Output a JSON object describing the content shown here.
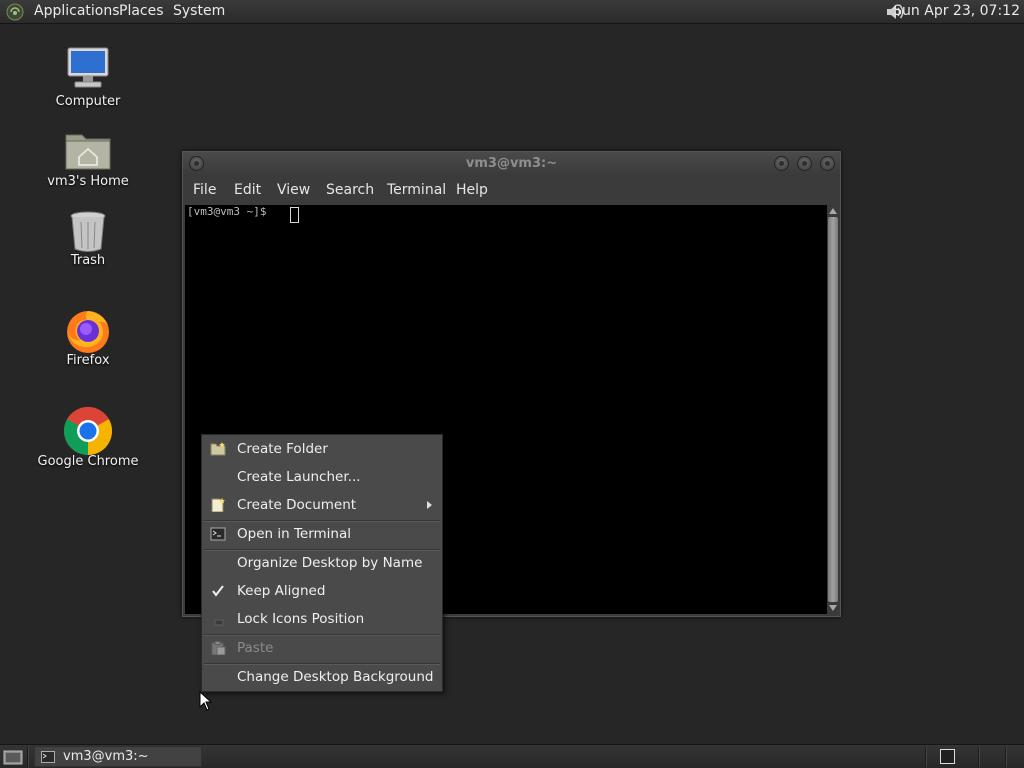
{
  "top_panel": {
    "menus": [
      "Applications",
      "Places",
      "System"
    ],
    "clock": "Sun Apr 23, 07:12",
    "icons": {
      "logo": "gnome-foot-icon",
      "volume": "speaker-icon"
    }
  },
  "desktop_icons": [
    {
      "label": "Computer",
      "icon": "computer-icon"
    },
    {
      "label": "vm3's Home",
      "icon": "home-folder-icon"
    },
    {
      "label": "Trash",
      "icon": "trash-icon"
    },
    {
      "label": "Firefox",
      "icon": "firefox-icon"
    },
    {
      "label": "Google Chrome",
      "icon": "chrome-icon"
    }
  ],
  "terminal": {
    "title": "vm3@vm3:~",
    "menus": [
      "File",
      "Edit",
      "View",
      "Search",
      "Terminal",
      "Help"
    ],
    "prompt": "[vm3@vm3 ~]$ "
  },
  "context_menu": {
    "items": [
      {
        "label": "Create Folder",
        "icon": "new-folder-icon",
        "enabled": true
      },
      {
        "label": "Create Launcher...",
        "icon": "",
        "enabled": true
      },
      {
        "label": "Create Document",
        "icon": "new-document-icon",
        "enabled": true,
        "submenu": true
      },
      {
        "label": "Open in Terminal",
        "icon": "terminal-icon",
        "enabled": true
      },
      {
        "label": "Organize Desktop by Name",
        "icon": "",
        "enabled": true
      },
      {
        "label": "Keep Aligned",
        "icon": "check-icon",
        "enabled": true,
        "checked": true
      },
      {
        "label": "Lock Icons Position",
        "icon": "unchecked-box-icon",
        "enabled": true,
        "checked": false
      },
      {
        "label": "Paste",
        "icon": "paste-icon",
        "enabled": false
      },
      {
        "label": "Change Desktop Background",
        "icon": "",
        "enabled": true
      }
    ]
  },
  "bottom_panel": {
    "task": "vm3@vm3:~"
  },
  "colors": {
    "desktop_bg": "#262626",
    "menu_bg": "#4a4a4a",
    "terminal_bg": "#000000"
  }
}
